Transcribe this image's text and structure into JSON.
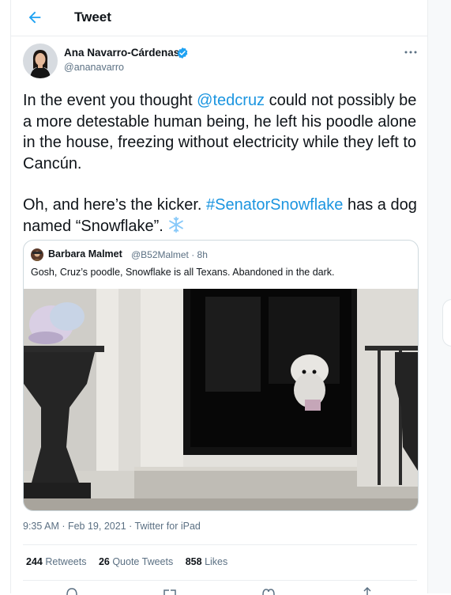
{
  "header": {
    "title": "Tweet"
  },
  "icons": {
    "back": "back-arrow-icon",
    "verified": "verified-badge-icon",
    "more": "more-options-icon",
    "reply": "reply-icon",
    "retweet": "retweet-icon",
    "like": "like-icon",
    "share": "share-icon"
  },
  "colors": {
    "accent": "#1b95e0",
    "verified": "#1da1f2",
    "secondary_text": "#5b7083"
  },
  "tweet": {
    "author_name": "Ana Navarro-Cárdenas",
    "author_handle": "@ananavarro",
    "text_part1": "In the event you thought ",
    "mention": "@tedcruz",
    "text_part2": " could not possibly be a more detestable human being, he left his poodle alone in the house, freezing without electricity while they left to Cancún.",
    "text_part3": "Oh, and here’s the kicker. ",
    "hashtag": "#SenatorSnowflake",
    "text_part4": " has a dog named “Snowflake”. ",
    "emoji": "❄️",
    "timestamp": "9:35 AM · Feb 19, 2021 · Twitter for iPad"
  },
  "quote": {
    "author_name": "Barbara Malmet",
    "author_handle": "@B52Malmet · 8h",
    "text": "Gosh, Cruz’s poodle, Snowflake is all Texans. Abandoned in the dark."
  },
  "stats": {
    "retweets_count": "244",
    "retweets_label": "Retweets",
    "quotes_count": "26",
    "quotes_label": "Quote Tweets",
    "likes_count": "858",
    "likes_label": "Likes"
  }
}
